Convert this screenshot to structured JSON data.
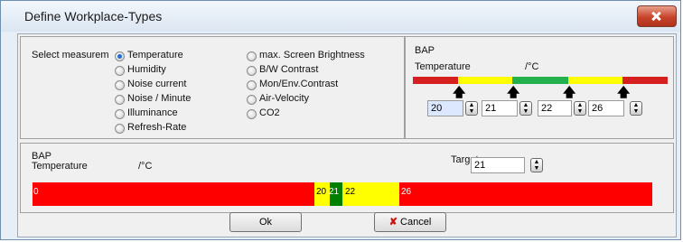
{
  "window": {
    "title": "Define Workplace-Types"
  },
  "measurement": {
    "label": "Select measurem",
    "options_left": [
      "Temperature",
      "Humidity",
      "Noise current",
      "Noise / Minute",
      "Illuminance",
      "Refresh-Rate"
    ],
    "options_right": [
      "max. Screen Brightness",
      "B/W Contrast",
      "Mon/Env.Contrast",
      "Air-Velocity",
      "CO2"
    ],
    "selected": "Temperature"
  },
  "bap_small": {
    "heading": "BAP",
    "param": "Temperature",
    "unit": "/°C",
    "colors": [
      "#d62020",
      "#ffff00",
      "#22b14c",
      "#ffff00",
      "#d62020"
    ],
    "thresholds": [
      "20",
      "21",
      "22",
      "26"
    ]
  },
  "bap_large": {
    "heading": "BAP",
    "param": "Temperature",
    "unit": "/°C",
    "target_label": "Target:",
    "target_value": "21",
    "labels": [
      "0",
      "20",
      "21",
      "22",
      "26"
    ],
    "colors": {
      "red": "#ff0000",
      "yellow": "#ffff00",
      "green": "#008000"
    }
  },
  "buttons": {
    "ok": "Ok",
    "cancel": "Cancel"
  }
}
